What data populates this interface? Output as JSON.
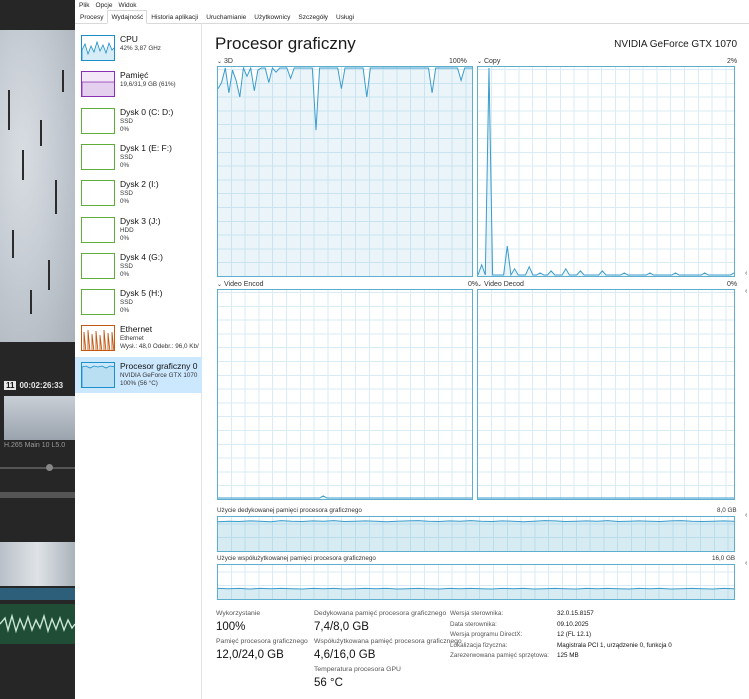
{
  "menu": [
    "Plik",
    "Opcje",
    "Widok"
  ],
  "tabs": [
    "Procesy",
    "Wydajność",
    "Historia aplikacji",
    "Uruchamianie",
    "Użytkownicy",
    "Szczegóły",
    "Usługi"
  ],
  "active_tab": "Wydajność",
  "sidebar": {
    "items": [
      {
        "name": "CPU",
        "line2": "42% 3,87 GHz",
        "line3": "",
        "color": "#1b8fc9"
      },
      {
        "name": "Pamięć",
        "line2": "19,6/31,9 GB (61%)",
        "line3": "",
        "color": "#8b2fb5"
      },
      {
        "name": "Dysk 0 (C: D:)",
        "line2": "SSD",
        "line3": "0%",
        "color": "#5fad3a"
      },
      {
        "name": "Dysk 1 (E: F:)",
        "line2": "SSD",
        "line3": "0%",
        "color": "#5fad3a"
      },
      {
        "name": "Dysk 2 (I:)",
        "line2": "SSD",
        "line3": "0%",
        "color": "#5fad3a"
      },
      {
        "name": "Dysk 3 (J:)",
        "line2": "HDD",
        "line3": "0%",
        "color": "#5fad3a"
      },
      {
        "name": "Dysk 4 (G:)",
        "line2": "SSD",
        "line3": "0%",
        "color": "#5fad3a"
      },
      {
        "name": "Dysk 5 (H:)",
        "line2": "SSD",
        "line3": "0%",
        "color": "#5fad3a"
      },
      {
        "name": "Ethernet",
        "line2": "Ethernet",
        "line3": "Wysł.: 48,0  Odebr.: 96,0 Kb/",
        "color": "#c25a16"
      },
      {
        "name": "Procesor graficzny 0",
        "line2": "NVIDIA GeForce GTX 1070",
        "line3": "100% (56 °C)",
        "color": "#1b8fc9"
      }
    ]
  },
  "main": {
    "title": "Procesor graficzny",
    "gpu_name": "NVIDIA GeForce GTX 1070",
    "graphs": {
      "g3d": {
        "label": "3D",
        "max": "100%"
      },
      "copy": {
        "label": "Copy",
        "max": "2%"
      },
      "venc": {
        "label": "Video Encod",
        "max": "0%"
      },
      "vdec": {
        "label": "Video Decod",
        "max": "0%"
      },
      "dedicated": {
        "label": "Użycie dedykowanej pamięci procesora graficznego",
        "max": "8,0 GB"
      },
      "shared": {
        "label": "Użycie współużytkowanej pamięci procesora graficznego",
        "max": "16,0 GB"
      }
    },
    "stats": {
      "utilization_label": "Wykorzystanie",
      "utilization_value": "100%",
      "gpu_mem_label": "Pamięć procesora graficznego",
      "gpu_mem_value": "12,0/24,0 GB",
      "dedicated_label": "Dedykowana pamięć procesora graficznego",
      "dedicated_value": "7,4/8,0 GB",
      "shared_label": "Współużytkowana pamięć procesora graficznego",
      "shared_value": "4,6/16,0 GB",
      "temp_label": "Temperatura procesora GPU",
      "temp_value": "56 °C"
    },
    "info": [
      {
        "k": "Wersja sterownika:",
        "v": "32.0.15.8157"
      },
      {
        "k": "Data sterownika:",
        "v": "09.10.2025"
      },
      {
        "k": "Wersja programu DirectX:",
        "v": "12 (FL 12.1)"
      },
      {
        "k": "Lokalizacja fizyczna:",
        "v": "Magistrala PCI 1, urządzenie 0, funkcja 0"
      },
      {
        "k": "Zarezerwowana pamięć sprzętowa:",
        "v": "125 MB"
      }
    ]
  },
  "editor": {
    "clip_num": "11",
    "timecode": "00:02:26:33",
    "codec": "H.265 Main 10 L5.0"
  },
  "series": {
    "g3d": [
      90,
      93,
      100,
      88,
      99,
      94,
      86,
      100,
      96,
      100,
      89,
      99,
      100,
      100,
      93,
      100,
      98,
      100,
      100,
      100,
      95,
      100,
      100,
      100,
      100,
      100,
      100,
      70,
      100,
      100,
      100,
      100,
      100,
      100,
      90,
      100,
      100,
      100,
      100,
      100,
      100,
      86,
      100,
      100,
      100,
      100,
      100,
      100,
      100,
      100,
      100,
      100,
      100,
      100,
      100,
      100,
      100,
      100,
      100,
      88,
      100,
      100,
      100,
      100,
      100,
      100,
      100,
      94,
      100,
      100,
      100
    ],
    "copy": [
      0,
      5,
      0,
      100,
      0,
      0,
      0,
      0,
      14,
      0,
      3,
      0,
      0,
      0,
      4,
      0,
      0,
      1,
      0,
      0,
      2,
      0,
      0,
      0,
      3,
      0,
      0,
      0,
      2,
      0,
      0,
      0,
      0,
      0,
      2,
      0,
      0,
      0,
      0,
      0,
      1,
      0,
      0,
      0,
      0,
      0,
      0,
      1,
      0,
      0,
      0,
      0,
      0,
      0,
      1,
      0,
      0,
      0,
      0,
      0,
      0,
      0,
      1,
      0,
      0,
      0,
      0,
      0,
      0,
      0,
      1
    ],
    "venc": [
      0,
      0,
      0,
      0,
      0,
      0,
      0,
      0,
      0,
      0,
      0,
      0,
      0,
      0,
      0,
      0,
      0,
      0,
      0,
      0,
      0,
      0,
      0,
      0,
      0,
      0,
      0,
      0,
      0,
      1,
      0,
      0,
      0,
      0,
      0,
      0,
      0,
      0,
      0,
      0,
      0,
      0,
      0,
      0,
      0,
      0,
      0,
      0,
      0,
      0,
      0,
      0,
      0,
      0,
      0,
      0,
      0,
      0,
      0,
      0,
      0,
      0,
      0,
      0,
      0,
      0,
      0,
      0,
      0,
      0,
      0
    ],
    "vdec": [
      0,
      0,
      0,
      0,
      0,
      0,
      0,
      0,
      0,
      0,
      0,
      0,
      0,
      0,
      0,
      0,
      0,
      0,
      0,
      0,
      0,
      0,
      0,
      0,
      0,
      0,
      0,
      0,
      0,
      0,
      0,
      0,
      0,
      0,
      0,
      0,
      0,
      0,
      0,
      0,
      0,
      0,
      0,
      0,
      0,
      0,
      0,
      0,
      0,
      0,
      0,
      0,
      0,
      0,
      0,
      0,
      0,
      0,
      0,
      0,
      0,
      0,
      0,
      0,
      0,
      0,
      0,
      0,
      0,
      0,
      0
    ],
    "dedicated": [
      88,
      90,
      89,
      91,
      90,
      88,
      92,
      90,
      89,
      91,
      90,
      92,
      89,
      90,
      91,
      90,
      88,
      90,
      91,
      92,
      90,
      89,
      91,
      90,
      92,
      90,
      89,
      91,
      90,
      88,
      90,
      92,
      91,
      89,
      90,
      91,
      90,
      92,
      89,
      90,
      91,
      90,
      89,
      91,
      92,
      90,
      89,
      90,
      91,
      90
    ],
    "shared": [
      30,
      29,
      30,
      28,
      30,
      29,
      30,
      29,
      28,
      30,
      29,
      30,
      28,
      29,
      30,
      29,
      30,
      28,
      29,
      30,
      29,
      28,
      30,
      29,
      30,
      29,
      28,
      30,
      29,
      30,
      28,
      29,
      30,
      29,
      28,
      30,
      29,
      30,
      29,
      28,
      30,
      29,
      30,
      28,
      29,
      30,
      29,
      28,
      30,
      29
    ]
  }
}
